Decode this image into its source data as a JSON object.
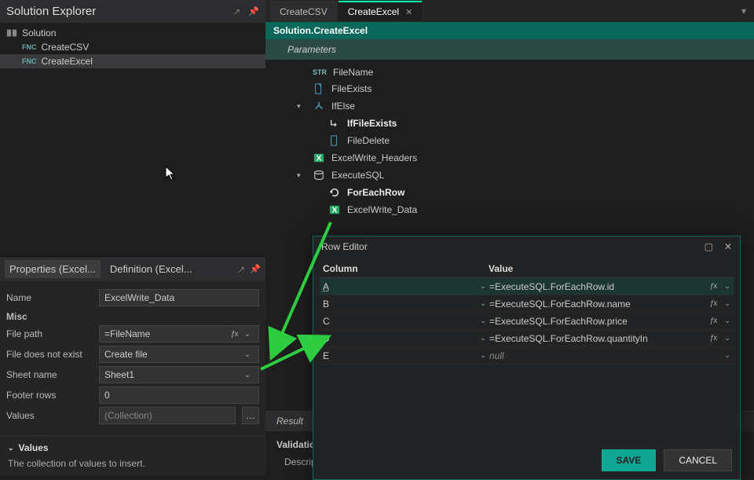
{
  "solution_explorer": {
    "title": "Solution Explorer",
    "root": "Solution",
    "items": [
      {
        "badge": "FNC",
        "name": "CreateCSV"
      },
      {
        "badge": "FNC",
        "name": "CreateExcel"
      }
    ]
  },
  "properties": {
    "tabs": {
      "props": "Properties (Excel...",
      "def": "Definition (Excel..."
    },
    "fields": {
      "name_label": "Name",
      "name_value": "ExcelWrite_Data",
      "misc_label": "Misc",
      "file_path_label": "File path",
      "file_path_value": "=FileName",
      "file_dne_label": "File does not exist",
      "file_dne_value": "Create file",
      "sheet_label": "Sheet name",
      "sheet_value": "Sheet1",
      "footer_label": "Footer rows",
      "footer_value": "0",
      "values_label": "Values",
      "values_value": "(Collection)"
    },
    "desc": {
      "title": "Values",
      "text": "The collection of values to insert."
    }
  },
  "editor": {
    "tabs": [
      {
        "label": "CreateCSV",
        "active": false
      },
      {
        "label": "CreateExcel",
        "active": true
      }
    ],
    "breadcrumb": "Solution.CreateExcel",
    "parameters_label": "Parameters",
    "nodes": {
      "filename": "FileName",
      "fileexists": "FileExists",
      "ifelse": "IfElse",
      "iffileexists": "IfFileExists",
      "filedelete": "FileDelete",
      "excelwrite_headers": "ExcelWrite_Headers",
      "executesql": "ExecuteSQL",
      "foreachrow": "ForEachRow",
      "excelwrite_data": "ExcelWrite_Data"
    },
    "bottom_tabs": {
      "result": "Result"
    },
    "validations_title": "Validations",
    "validations_desc_label": "Descriptio"
  },
  "row_editor": {
    "title": "Row Editor",
    "col_header": "Column",
    "val_header": "Value",
    "rows": [
      {
        "col": "A",
        "val": "=ExecuteSQL.ForEachRow.id",
        "has_fx": true
      },
      {
        "col": "B",
        "val": "=ExecuteSQL.ForEachRow.name",
        "has_fx": true
      },
      {
        "col": "C",
        "val": "=ExecuteSQL.ForEachRow.price",
        "has_fx": true
      },
      {
        "col": "D",
        "val": "=ExecuteSQL.ForEachRow.quantityIn",
        "has_fx": true
      },
      {
        "col": "E",
        "val": "null",
        "has_fx": false,
        "null": true
      }
    ],
    "save": "SAVE",
    "cancel": "CANCEL"
  }
}
